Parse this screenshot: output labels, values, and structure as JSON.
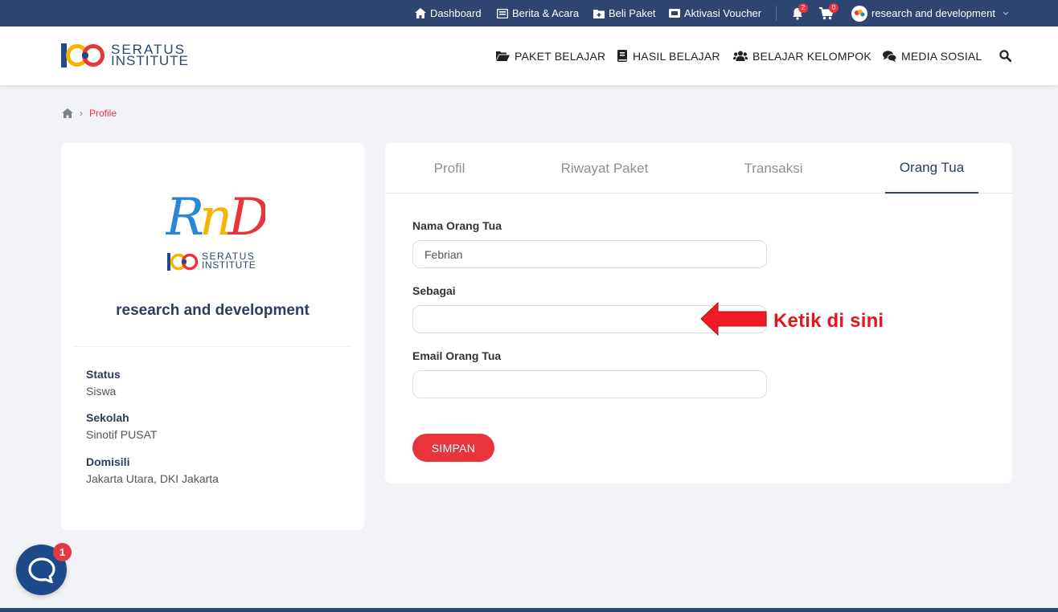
{
  "topbar": {
    "dashboard": "Dashboard",
    "news": "Berita & Acara",
    "buy": "Beli Paket",
    "voucher": "Aktivasi Voucher",
    "notif_count": "2",
    "cart_count": "0",
    "user_name": "research and development"
  },
  "brand": {
    "line1": "SERATUS",
    "line2": "INSTITUTE"
  },
  "nav": {
    "paket": "PAKET BELAJAR",
    "hasil": "HASIL BELAJAR",
    "kelompok": "BELAJAR KELOMPOK",
    "sosial": "MEDIA SOSIAL"
  },
  "breadcrumb": {
    "current": "Profile"
  },
  "profile_card": {
    "logo_text": "RnD",
    "logo_brand_1": "SERATUS",
    "logo_brand_2": "INSTITUTE",
    "name": "research and development",
    "status_label": "Status",
    "status_value": "Siswa",
    "school_label": "Sekolah",
    "school_value": "Sinotif PUSAT",
    "domicile_label": "Domisili",
    "domicile_value": "Jakarta Utara, DKI Jakarta"
  },
  "tabs": [
    "Profil",
    "Riwayat Paket",
    "Transaksi",
    "Orang Tua"
  ],
  "active_tab": "Orang Tua",
  "form": {
    "parent_name_label": "Nama Orang Tua",
    "parent_name_value": "Febrian",
    "as_label": "Sebagai",
    "as_value": "",
    "email_label": "Email Orang Tua",
    "email_value": "",
    "save_label": "SIMPAN"
  },
  "annotation": {
    "text": "Ketik di sini"
  },
  "chat": {
    "badge": "1"
  },
  "colors": {
    "navy": "#2c4671",
    "accent_red": "#e8343a"
  }
}
